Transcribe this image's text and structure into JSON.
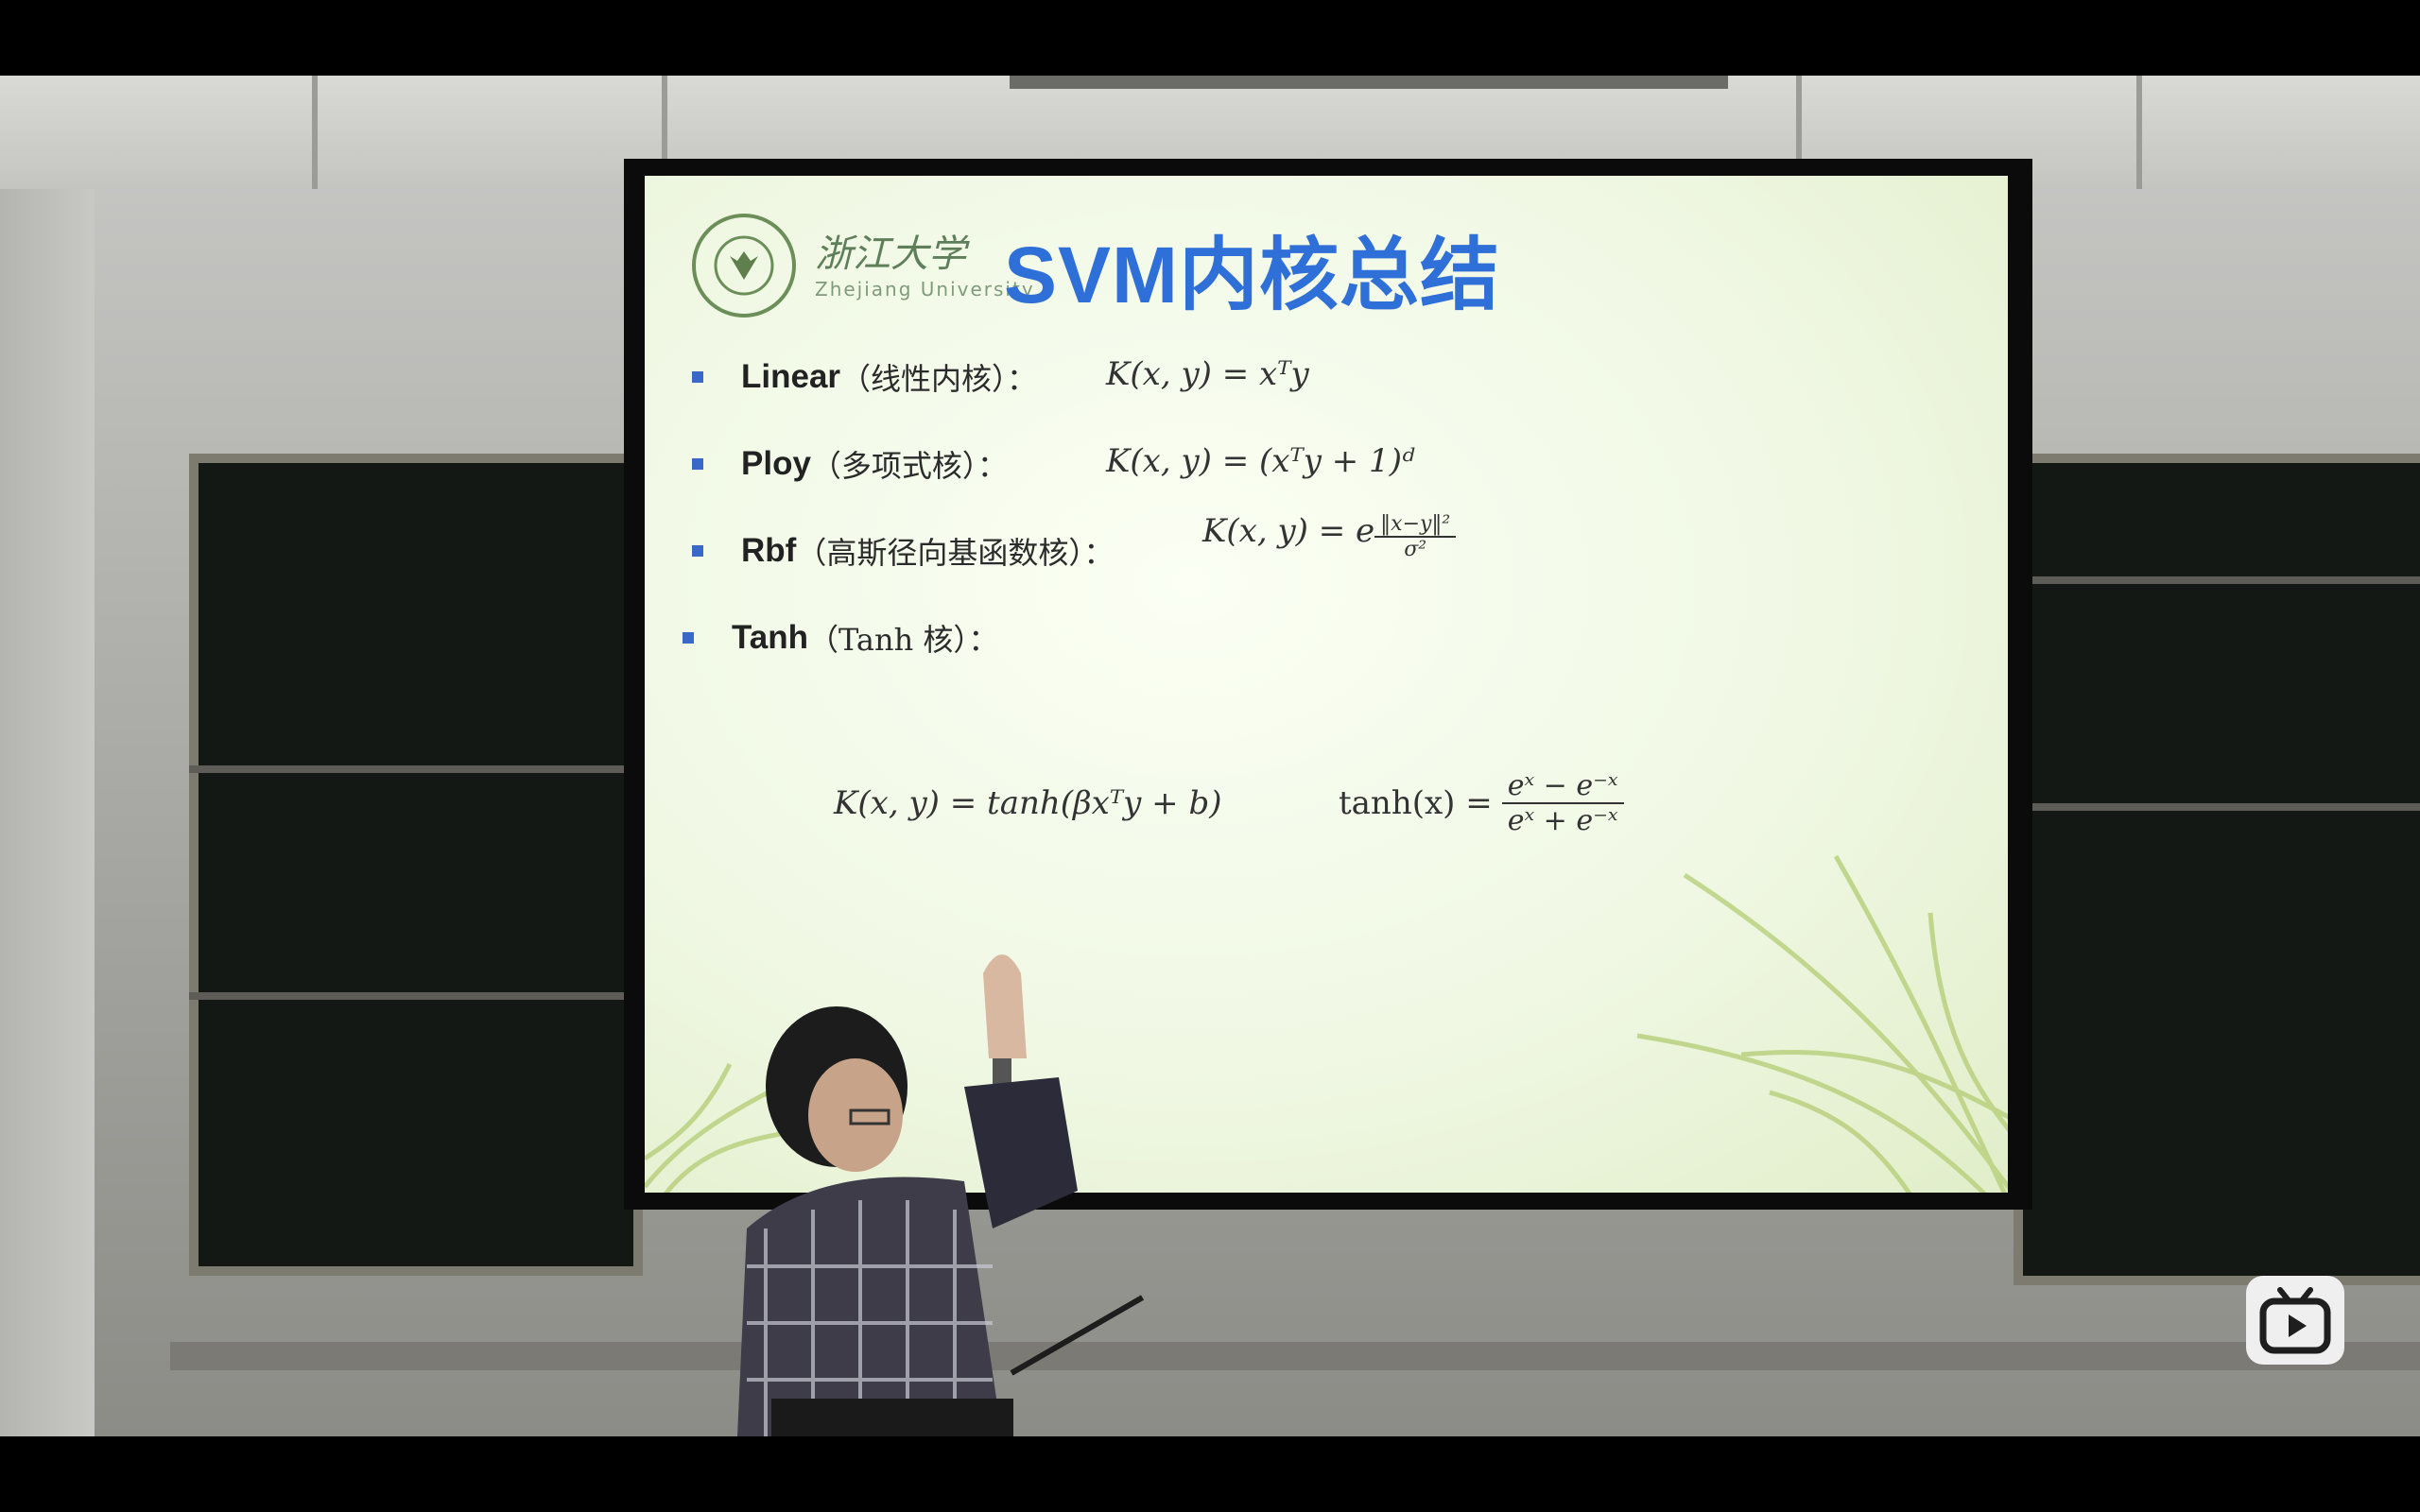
{
  "slide": {
    "logo_text": "浙江大学",
    "logo_subtext": "Zhejiang University",
    "title": "SVM内核总结",
    "items": [
      {
        "label": "Linear",
        "paren": "（线性内核）：",
        "formula": "K(x, y) = xᵀy"
      },
      {
        "label": "Ploy",
        "paren": "（多项式核）：",
        "formula": "K(x, y) = (xᵀy + 1)ᵈ"
      },
      {
        "label": "Rbf",
        "paren": "（高斯径向基函数核）：",
        "formula_prefix": "K(x, y) = e",
        "exp_num": "‖x−y‖²",
        "exp_den": "σ²"
      },
      {
        "label": "Tanh",
        "paren": "（Tanh 核）："
      }
    ],
    "tanh_formula": "K(x, y) = tanh(βxᵀy + b)",
    "tanh_def_lhs": "tanh(x) =",
    "tanh_def_num": "eˣ − e⁻ˣ",
    "tanh_def_den": "eˣ + e⁻ˣ"
  },
  "player": {
    "icon": "bilibili-tv-icon"
  },
  "colors": {
    "title": "#2f6fd8",
    "bullet": "#3a68c8",
    "slide_bg": "#f0f8e4"
  }
}
